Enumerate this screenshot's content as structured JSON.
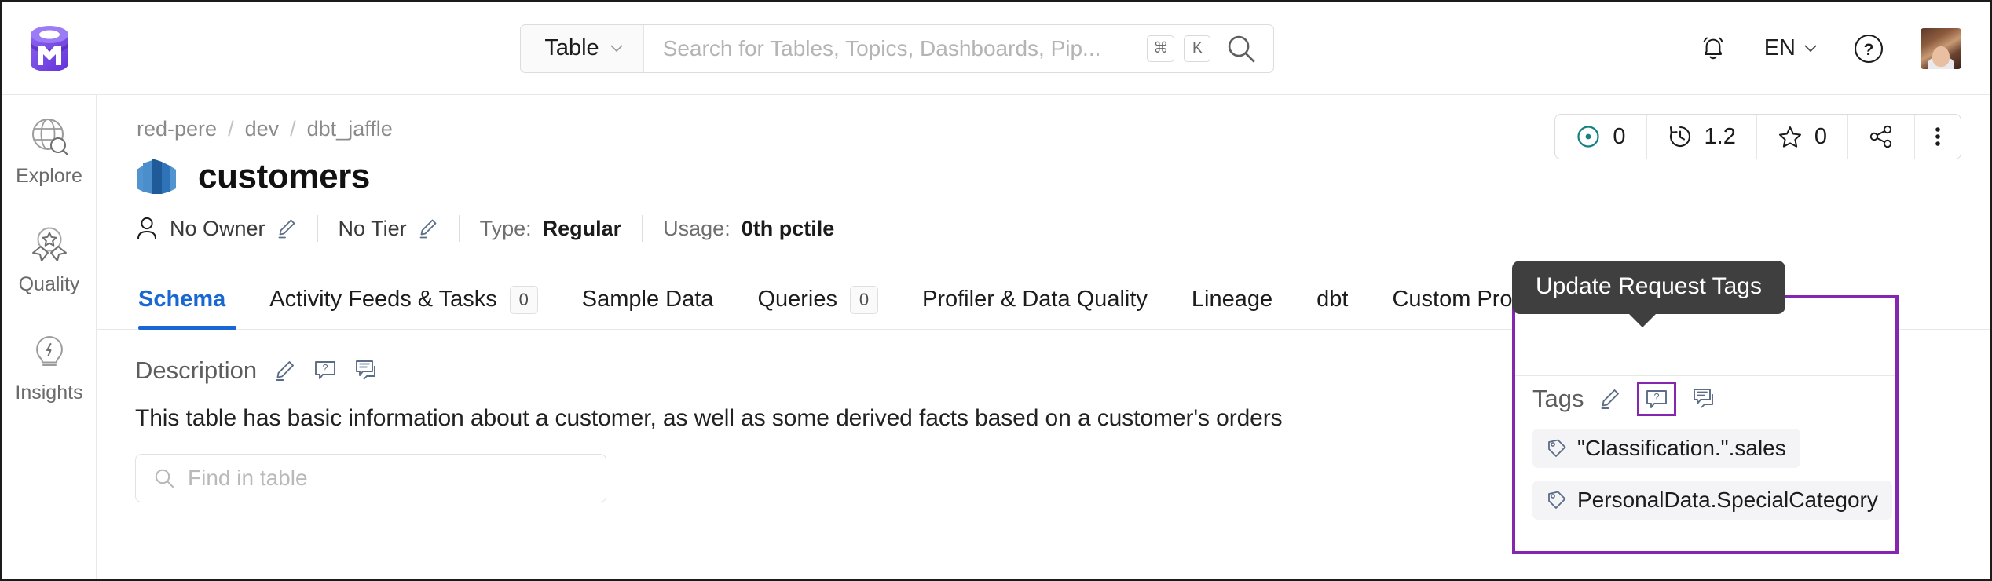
{
  "header": {
    "logo_icon": "openmetadata-cylinder-logo",
    "search": {
      "entity_type": "Table",
      "placeholder": "Search for Tables, Topics, Dashboards, Pip...",
      "value": "",
      "shortcut_keys": [
        "⌘",
        "K"
      ],
      "search_icon": "search-icon",
      "dropdown_icon": "chevron-down-icon"
    },
    "notifications_icon": "bell-icon",
    "language": "EN",
    "language_icon": "chevron-down-icon",
    "help_icon": "question-circle-icon",
    "avatar_icon": "user-avatar"
  },
  "sidebar": {
    "items": [
      {
        "label": "Explore",
        "icon": "globe-search-icon"
      },
      {
        "label": "Quality",
        "icon": "award-ribbon-icon"
      },
      {
        "label": "Insights",
        "icon": "lightbulb-icon"
      }
    ]
  },
  "breadcrumb": {
    "items": [
      "red-pere",
      "dev",
      "dbt_jaffle"
    ],
    "separator": "/"
  },
  "entity": {
    "name": "customers",
    "icon": "redshift-table-icon",
    "owner_label": "No Owner",
    "owner_icon": "user-icon",
    "owner_edit_icon": "pencil-icon",
    "tier_label": "No Tier",
    "tier_edit_icon": "pencil-icon",
    "type_key": "Type:",
    "type_value": "Regular",
    "usage_key": "Usage:",
    "usage_value": "0th pctile"
  },
  "actions": [
    {
      "name": "announcement",
      "icon": "dot-circle-icon",
      "value": "0"
    },
    {
      "name": "version",
      "icon": "history-clock-icon",
      "value": "1.2"
    },
    {
      "name": "followers",
      "icon": "star-icon",
      "value": "0"
    },
    {
      "name": "share",
      "icon": "share-nodes-icon",
      "value": ""
    },
    {
      "name": "more",
      "icon": "kebab-menu-icon",
      "value": ""
    }
  ],
  "tabs": [
    {
      "label": "Schema",
      "count": null,
      "active": true
    },
    {
      "label": "Activity Feeds & Tasks",
      "count": "0",
      "active": false
    },
    {
      "label": "Sample Data",
      "count": null,
      "active": false
    },
    {
      "label": "Queries",
      "count": "0",
      "active": false
    },
    {
      "label": "Profiler & Data Quality",
      "count": null,
      "active": false
    },
    {
      "label": "Lineage",
      "count": null,
      "active": false
    },
    {
      "label": "dbt",
      "count": null,
      "active": false
    },
    {
      "label": "Custom Properties",
      "count": null,
      "active": false
    }
  ],
  "description": {
    "title": "Description",
    "edit_icon": "pencil-icon",
    "request_icon": "request-description-icon",
    "comment_icon": "comment-icon",
    "text": "This table has basic information about a customer, as well as some derived facts based on a customer's orders"
  },
  "find_in_table": {
    "placeholder": "Find in table",
    "value": "",
    "icon": "search-icon"
  },
  "tags_panel": {
    "tooltip": "Update Request Tags",
    "label": "Tags",
    "edit_icon": "pencil-icon",
    "request_icon": "request-tags-icon",
    "comment_icon": "comment-icon",
    "tags": [
      {
        "label": "\"Classification.\".sales",
        "icon": "tag-icon"
      },
      {
        "label": "PersonalData.SpecialCategory",
        "icon": "tag-icon"
      }
    ],
    "highlight_color": "#8526b0"
  },
  "colors": {
    "accent_blue": "#1867d2",
    "highlight_purple": "#8526b0",
    "brand_purple": "#7147e8",
    "teal": "#11827f",
    "tooltip_bg": "#3f3f3f"
  }
}
